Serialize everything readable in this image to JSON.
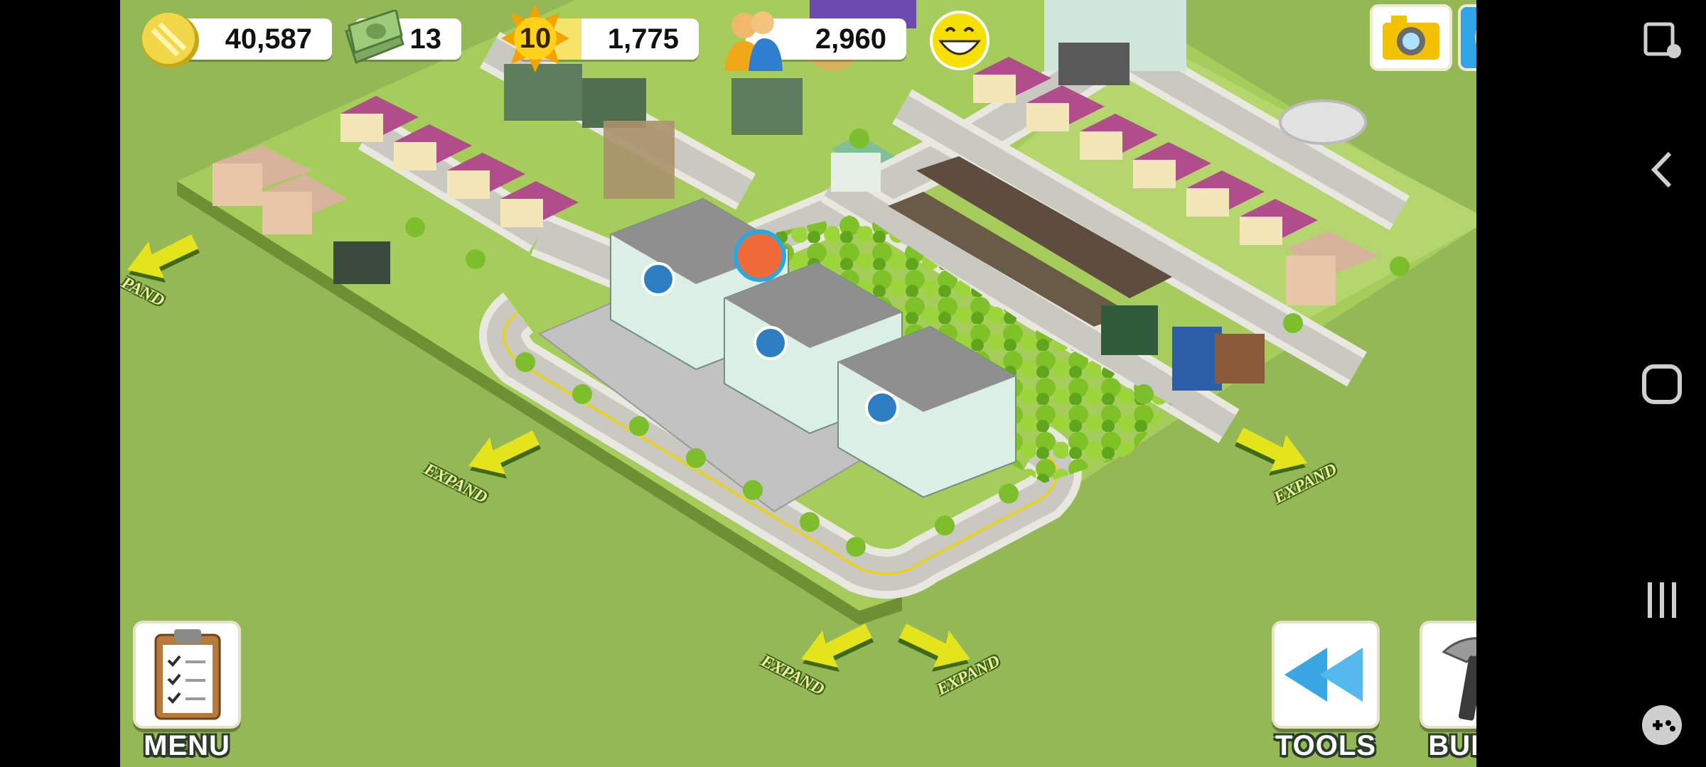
{
  "hud": {
    "coins": "40,587",
    "cash": "13",
    "level": "10",
    "xp": "1,775",
    "population": "2,960",
    "xp_progress": 0.35
  },
  "expand_labels": {
    "left_cut": "PAND",
    "left": "EXPAND",
    "right": "EXPAND",
    "bottom_left": "EXPAND",
    "bottom_right": "EXPAND"
  },
  "buttons": {
    "menu": "MENU",
    "tools": "TOOLS",
    "build": "BUILD"
  },
  "icons": {
    "top_right": [
      "camera-icon",
      "share-icon"
    ],
    "system_nav": [
      "screen-capture-icon",
      "back-icon",
      "home-icon",
      "recent-apps-icon",
      "game-tools-icon"
    ]
  },
  "colors": {
    "grass": "#94b856",
    "arrow": "#e4e41c",
    "arrow_shadow": "#3e6a18",
    "label_outline": "#2c3a2a"
  }
}
